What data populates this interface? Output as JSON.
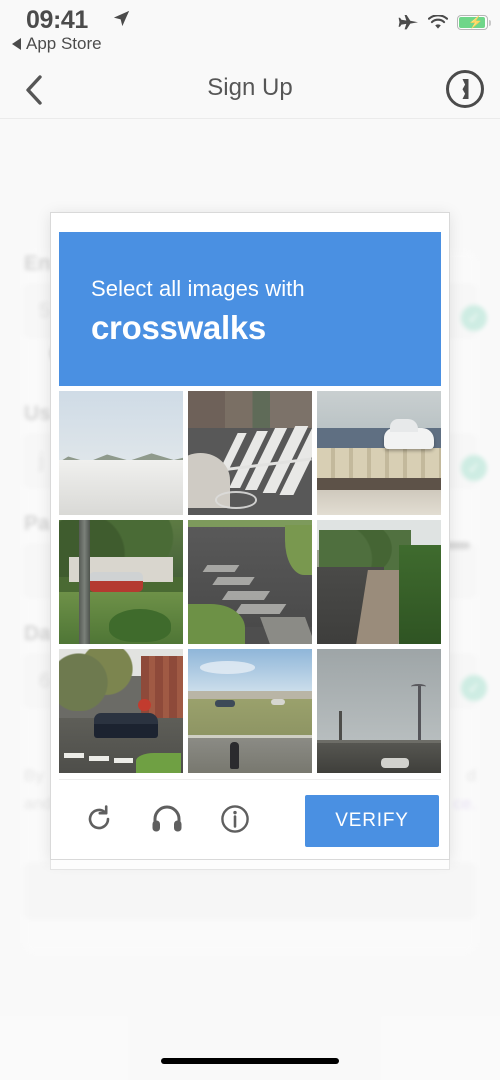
{
  "statusbar": {
    "time": "09:41",
    "back_label": "App Store",
    "location_icon": "location-arrow-icon",
    "airplane_icon": "airplane-mode-icon",
    "wifi_icon": "wifi-icon",
    "battery_icon": "battery-charging-icon"
  },
  "navbar": {
    "back_icon": "chevron-left-icon",
    "title": "Sign Up",
    "password_manager_icon": "onepassword-keyhole-icon"
  },
  "background_form": {
    "fields": [
      {
        "label": "En",
        "value": "5",
        "verified": true
      },
      {
        "label": "Us",
        "value": "j",
        "verified": true
      },
      {
        "label": "Pa",
        "value": "",
        "verified": false
      },
      {
        "label": "Da",
        "value": "6",
        "verified": true
      }
    ],
    "phone_icon": "phone-icon",
    "terms_prefix": "By",
    "terms_line2": "and",
    "terms_tail1": "d",
    "terms_tail2": "ce."
  },
  "captcha": {
    "prompt_line1": "Select all images with",
    "prompt_target": "crosswalks",
    "header_color": "#4a90e2",
    "verify_label": "VERIFY",
    "reload_icon": "reload-icon",
    "audio_icon": "headphones-icon",
    "info_icon": "info-icon",
    "tiles": [
      {
        "index": 1,
        "alt": "white barrier with distant mountains",
        "selected": false
      },
      {
        "index": 2,
        "alt": "street crosswalk with bike lane marking",
        "selected": false
      },
      {
        "index": 3,
        "alt": "bridge railing with white car",
        "selected": false
      },
      {
        "index": 4,
        "alt": "red car parked near grass and utility pole",
        "selected": false
      },
      {
        "index": 5,
        "alt": "faded crosswalk on residential street",
        "selected": false
      },
      {
        "index": 6,
        "alt": "sidewalk lined with hedges",
        "selected": false
      },
      {
        "index": 7,
        "alt": "street with dark van and crosswalk stripes",
        "selected": false
      },
      {
        "index": 8,
        "alt": "open field with road and pedestrian",
        "selected": false
      },
      {
        "index": 9,
        "alt": "gray sky over distant roadway",
        "selected": false
      }
    ]
  },
  "home_indicator": "home-indicator"
}
